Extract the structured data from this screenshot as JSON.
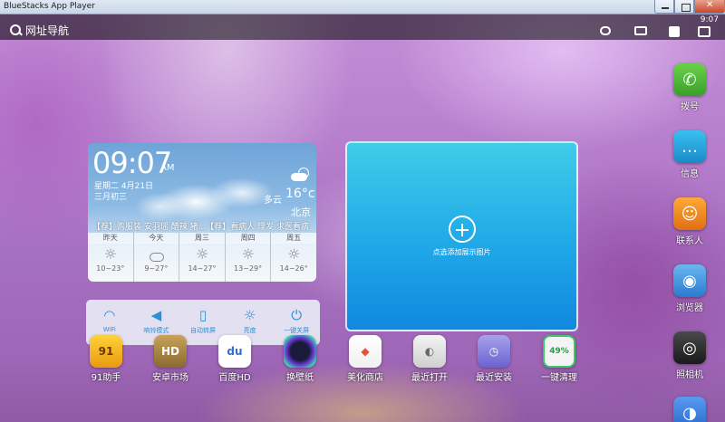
{
  "window": {
    "title": "BlueStacks App Player"
  },
  "statusbar": {
    "time": "9:07",
    "search_label": "网址导航"
  },
  "clock": {
    "time": "09:07",
    "ampm": "AM",
    "date": "星期二   4月21日",
    "lunar": "三月初三",
    "condition": "多云",
    "temperature": "16°c",
    "city": "北京",
    "news": "【荐】购服装 安羽瑶 醋辣 猪...【荐】看病人 理发 求医看病",
    "forecast": [
      {
        "day": "昨天",
        "icon": "sun-icon",
        "temp": "10~23°"
      },
      {
        "day": "今天",
        "icon": "cloud-icon",
        "temp": "9~27°"
      },
      {
        "day": "周三",
        "icon": "sun-icon",
        "temp": "14~27°"
      },
      {
        "day": "周四",
        "icon": "sun-icon",
        "temp": "13~29°"
      },
      {
        "day": "周五",
        "icon": "sun-icon",
        "temp": "14~26°"
      }
    ]
  },
  "toggles": [
    {
      "label": "WiFi",
      "icon": "wifi-icon"
    },
    {
      "label": "响铃模式",
      "icon": "speaker-icon"
    },
    {
      "label": "自动转屏",
      "icon": "rotate-icon"
    },
    {
      "label": "亮度",
      "icon": "brightness-icon"
    },
    {
      "label": "一键关屏",
      "icon": "power-icon"
    }
  ],
  "photo_widget": {
    "label": "点选添加展示图片"
  },
  "apps": [
    {
      "label": "91助手",
      "icon": "91-assistant-icon",
      "color": "#f3b21a"
    },
    {
      "label": "安卓市场",
      "icon": "android-market-icon",
      "color": "#86b34a"
    },
    {
      "label": "百度HD",
      "icon": "baidu-icon",
      "color": "#2b6fd6"
    },
    {
      "label": "换壁纸",
      "icon": "wallpaper-icon",
      "color": "#4a2a7a"
    },
    {
      "label": "美化商店",
      "icon": "theme-store-icon",
      "color": "#e8503a"
    },
    {
      "label": "最近打开",
      "icon": "recent-icon",
      "color": "#d8d8d8"
    },
    {
      "label": "最近安装",
      "icon": "clock-icon",
      "color": "#8e86e0"
    },
    {
      "label": "一键清理",
      "icon": "cleanup-icon",
      "color": "#e8e8e8",
      "badge": "49%"
    }
  ],
  "dock": [
    {
      "label": "拨号",
      "icon": "phone-icon",
      "color": "#4cba3a"
    },
    {
      "label": "信息",
      "icon": "message-icon",
      "color": "#19a4d8"
    },
    {
      "label": "联系人",
      "icon": "contacts-icon",
      "color": "#f08a1a"
    },
    {
      "label": "浏览器",
      "icon": "browser-icon",
      "color": "#3a9ae0"
    },
    {
      "label": "照相机",
      "icon": "camera-icon",
      "color": "#2a2a2a"
    },
    {
      "label": "",
      "icon": "settings-toggle-icon",
      "color": "#3a7ae0"
    }
  ]
}
